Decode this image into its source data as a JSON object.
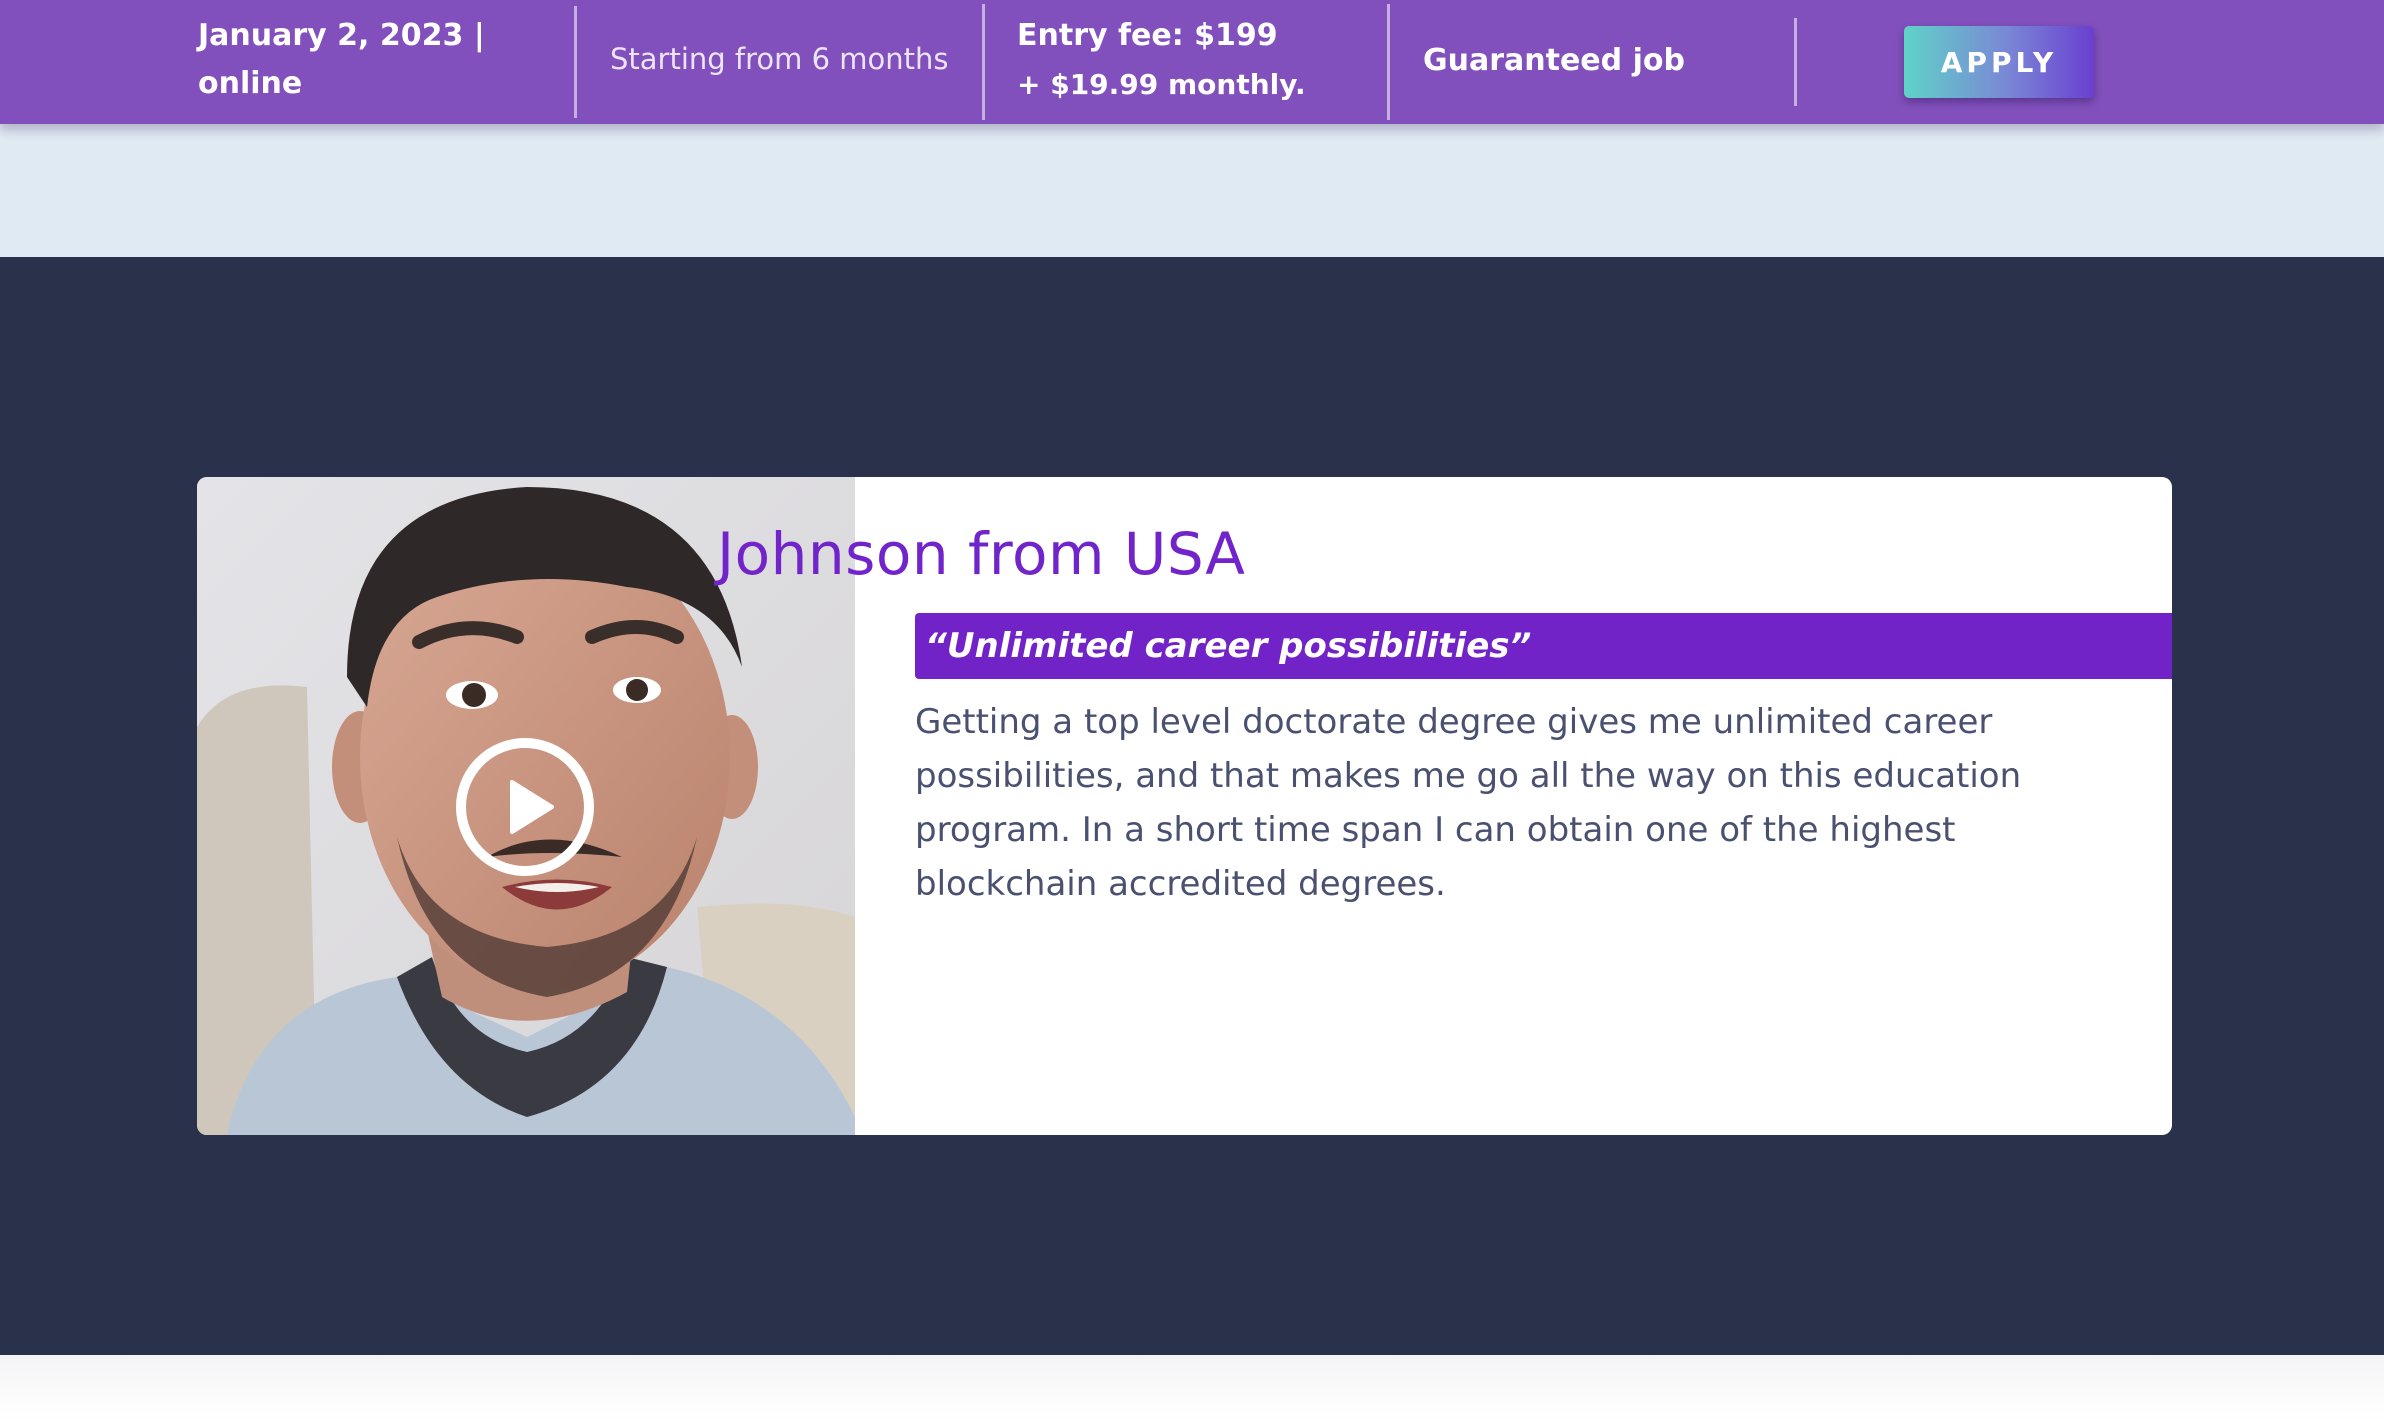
{
  "topbar": {
    "date_line1": "January 2, 2023 |",
    "date_line2": "online",
    "duration": "Starting from 6 months",
    "fee_line1": "Entry fee: $199",
    "fee_line2": "+ $19.99 monthly.",
    "guarantee": "Guaranteed job",
    "apply_label": "APPLY"
  },
  "testimonial": {
    "name": "Johnson from USA",
    "quote": "“Unlimited career possibilities”",
    "body": "Getting a top level doctorate degree gives me unlimited career possibilities, and that makes me go all the way on this education program. In a short time span I can obtain one of the highest blockchain accredited degrees."
  },
  "icons": {
    "play": "play-icon"
  },
  "colors": {
    "topbar": "#8150bc",
    "light_band": "#dfeaf3",
    "dark_section": "#29314b",
    "accent_purple": "#7124c9",
    "body_text": "#4a5170"
  }
}
